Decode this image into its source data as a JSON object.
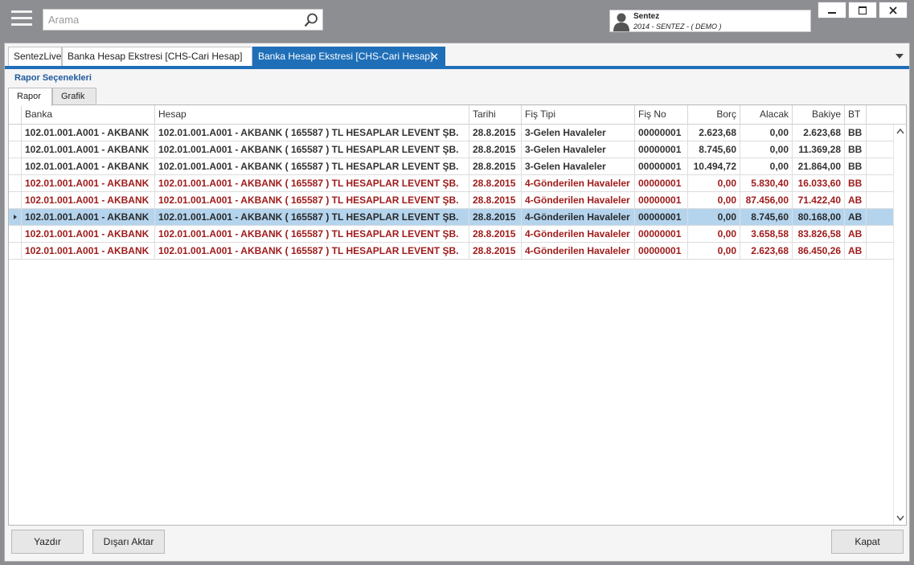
{
  "search": {
    "placeholder": "Arama"
  },
  "user": {
    "name": "Sentez",
    "subtitle": "2014 - SENTEZ - ( DEMO )"
  },
  "window_controls": {
    "minimize": "–",
    "maximize": "□",
    "close": "✕"
  },
  "tabs": [
    {
      "label": "SentezLive"
    },
    {
      "label": "Banka Hesap Ekstresi [CHS-Cari Hesap]"
    },
    {
      "label": "Banka Hesap Ekstresi [CHS-Cari Hesap]",
      "close": "✕"
    }
  ],
  "section_title": "Rapor Seçenekleri",
  "sub_tabs": [
    {
      "label": "Rapor"
    },
    {
      "label": "Grafik"
    }
  ],
  "grid": {
    "columns": [
      "Banka",
      "Hesap",
      "Tarihi",
      "Fiş Tipi",
      "Fiş No",
      "Borç",
      "Alacak",
      "Bakiye",
      "BT"
    ],
    "rows": [
      {
        "banka": "102.01.001.A001 - AKBANK",
        "hesap": "102.01.001.A001 - AKBANK ( 165587 ) TL HESAPLAR LEVENT ŞB.",
        "tarihi": "28.8.2015",
        "fis_tipi": "3-Gelen Havaleler",
        "fis_no": "00000001",
        "borc": "2.623,68",
        "alacak": "0,00",
        "bakiye": "2.623,68",
        "bt": "BB"
      },
      {
        "banka": "102.01.001.A001 - AKBANK",
        "hesap": "102.01.001.A001 - AKBANK ( 165587 ) TL HESAPLAR LEVENT ŞB.",
        "tarihi": "28.8.2015",
        "fis_tipi": "3-Gelen Havaleler",
        "fis_no": "00000001",
        "borc": "8.745,60",
        "alacak": "0,00",
        "bakiye": "11.369,28",
        "bt": "BB"
      },
      {
        "banka": "102.01.001.A001 - AKBANK",
        "hesap": "102.01.001.A001 - AKBANK ( 165587 ) TL HESAPLAR LEVENT ŞB.",
        "tarihi": "28.8.2015",
        "fis_tipi": "3-Gelen Havaleler",
        "fis_no": "00000001",
        "borc": "10.494,72",
        "alacak": "0,00",
        "bakiye": "21.864,00",
        "bt": "BB"
      },
      {
        "banka": "102.01.001.A001 - AKBANK",
        "hesap": "102.01.001.A001 - AKBANK ( 165587 ) TL HESAPLAR LEVENT ŞB.",
        "tarihi": "28.8.2015",
        "fis_tipi": "4-Gönderilen Havaleler",
        "fis_no": "00000001",
        "borc": "0,00",
        "alacak": "5.830,40",
        "bakiye": "16.033,60",
        "bt": "BB"
      },
      {
        "banka": "102.01.001.A001 - AKBANK",
        "hesap": "102.01.001.A001 - AKBANK ( 165587 ) TL HESAPLAR LEVENT ŞB.",
        "tarihi": "28.8.2015",
        "fis_tipi": "4-Gönderilen Havaleler",
        "fis_no": "00000001",
        "borc": "0,00",
        "alacak": "87.456,00",
        "bakiye": "71.422,40",
        "bt": "AB"
      },
      {
        "banka": "102.01.001.A001 - AKBANK",
        "hesap": "102.01.001.A001 - AKBANK ( 165587 ) TL HESAPLAR LEVENT ŞB.",
        "tarihi": "28.8.2015",
        "fis_tipi": "4-Gönderilen Havaleler",
        "fis_no": "00000001",
        "borc": "0,00",
        "alacak": "8.745,60",
        "bakiye": "80.168,00",
        "bt": "AB"
      },
      {
        "banka": "102.01.001.A001 - AKBANK",
        "hesap": "102.01.001.A001 - AKBANK ( 165587 ) TL HESAPLAR LEVENT ŞB.",
        "tarihi": "28.8.2015",
        "fis_tipi": "4-Gönderilen Havaleler",
        "fis_no": "00000001",
        "borc": "0,00",
        "alacak": "3.658,58",
        "bakiye": "83.826,58",
        "bt": "AB"
      },
      {
        "banka": "102.01.001.A001 - AKBANK",
        "hesap": "102.01.001.A001 - AKBANK ( 165587 ) TL HESAPLAR LEVENT ŞB.",
        "tarihi": "28.8.2015",
        "fis_tipi": "4-Gönderilen Havaleler",
        "fis_no": "00000001",
        "borc": "0,00",
        "alacak": "2.623,68",
        "bakiye": "86.450,26",
        "bt": "AB"
      }
    ]
  },
  "footer": {
    "print": "Yazdır",
    "export": "Dışarı Aktar",
    "close": "Kapat"
  },
  "colors": {
    "accent": "#1f6fb8",
    "negative_row": "#a01b1b",
    "selected_row": "#b4d4ee"
  }
}
